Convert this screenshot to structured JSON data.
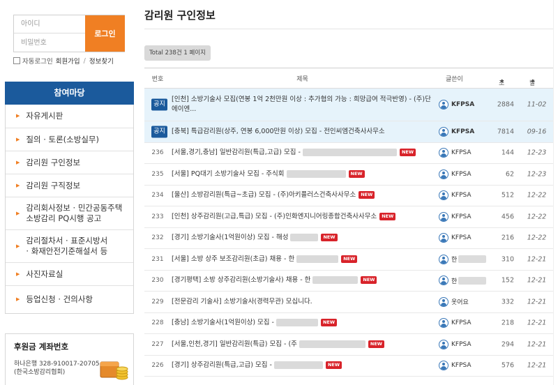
{
  "login": {
    "id_placeholder": "아이디",
    "pw_placeholder": "비밀번호",
    "button": "로그인",
    "auto_login": "자동로그인",
    "join": "회원가입",
    "find": "정보찾기"
  },
  "menu": {
    "title": "참여마당",
    "items": [
      {
        "label": "자유게시판"
      },
      {
        "label": "질의 · 토론(소방실무)"
      },
      {
        "label": "감리원 구인정보"
      },
      {
        "label": "감리원 구직정보"
      },
      {
        "label": "감리회사정보 · 민간공동주택\n소방감리 PQ시행 공고"
      },
      {
        "label": "감리절차서 · 표준시방서\n· 화재안전기준해설서 등"
      },
      {
        "label": "사진자료실"
      },
      {
        "label": "등업신청 · 건의사항"
      }
    ]
  },
  "bank": {
    "title": "후원금 계좌번호",
    "info": "하나은행 328-910017-20705\n(한국소방감리협회)"
  },
  "page_title": "감리원 구인정보",
  "total": "Total 238건 1 페이지",
  "columns": {
    "num": "번호",
    "subject": "제목",
    "author": "글쓴이",
    "views": "조회",
    "date": "날짜"
  },
  "notices": [
    {
      "badge": "공지",
      "subject": "[인천] 소방기술사 모집(연봉 1억 2천만원 이상 : 추가협의 가능 : 희망급여 적극반영) - (주)단에이엔...",
      "author": "KFPSA",
      "views": "2884",
      "date": "11-02"
    },
    {
      "badge": "공지",
      "subject": "[충북] 특급감리원(상주, 연봉 6,000만원 이상) 모집 - 전인씨엠건축사사무소",
      "author": "KFPSA",
      "views": "7814",
      "date": "09-16"
    }
  ],
  "new_label": "NEW",
  "rows": [
    {
      "num": "236",
      "subject": "[서울,경기,충남] 일반감리원(특급,고급) 모집 -",
      "author": "KFPSA",
      "views": "144",
      "date": "12-23"
    },
    {
      "num": "235",
      "subject": "[서울] PQ대기 소방기술사 모집 - 주식회",
      "author": "KFPSA",
      "views": "62",
      "date": "12-23"
    },
    {
      "num": "234",
      "subject": "[울산] 소방감리원(특급~초급) 모집 - (주)아키플러스건축사사무소",
      "author": "KFPSA",
      "views": "512",
      "date": "12-22"
    },
    {
      "num": "233",
      "subject": "[인천] 상주감리원(고급,특급) 모집 - (주)인화엔지니어링종합건축사사무소",
      "author": "KFPSA",
      "views": "456",
      "date": "12-22"
    },
    {
      "num": "232",
      "subject": "[경기] 소방기술사(1억원이상) 모집 - 해성",
      "author": "KFPSA",
      "views": "216",
      "date": "12-22"
    },
    {
      "num": "231",
      "subject": "[서울] 소방 상주 보조감리원(초급) 채용 - 한",
      "author": "한",
      "views": "310",
      "date": "12-21"
    },
    {
      "num": "230",
      "subject": "[경기평택] 소방 상주감리원(소방기술사) 채용 - 한",
      "author": "한",
      "views": "152",
      "date": "12-21"
    },
    {
      "num": "229",
      "subject": "[전문감리 기술사] 소방기술사(경력무관) 모십니다.",
      "author": "옷어요",
      "views": "332",
      "date": "12-21"
    },
    {
      "num": "228",
      "subject": "[충남] 소방기술사(1억원이상) 모집 -",
      "author": "KFPSA",
      "views": "218",
      "date": "12-21"
    },
    {
      "num": "227",
      "subject": "[서울,인천,경기] 일반감리원(특급) 모집 - (주",
      "author": "KFPSA",
      "views": "294",
      "date": "12-21"
    },
    {
      "num": "226",
      "subject": "[경기] 상주감리원(특급,고급) 모집 -",
      "author": "KFPSA",
      "views": "576",
      "date": "12-21"
    }
  ]
}
